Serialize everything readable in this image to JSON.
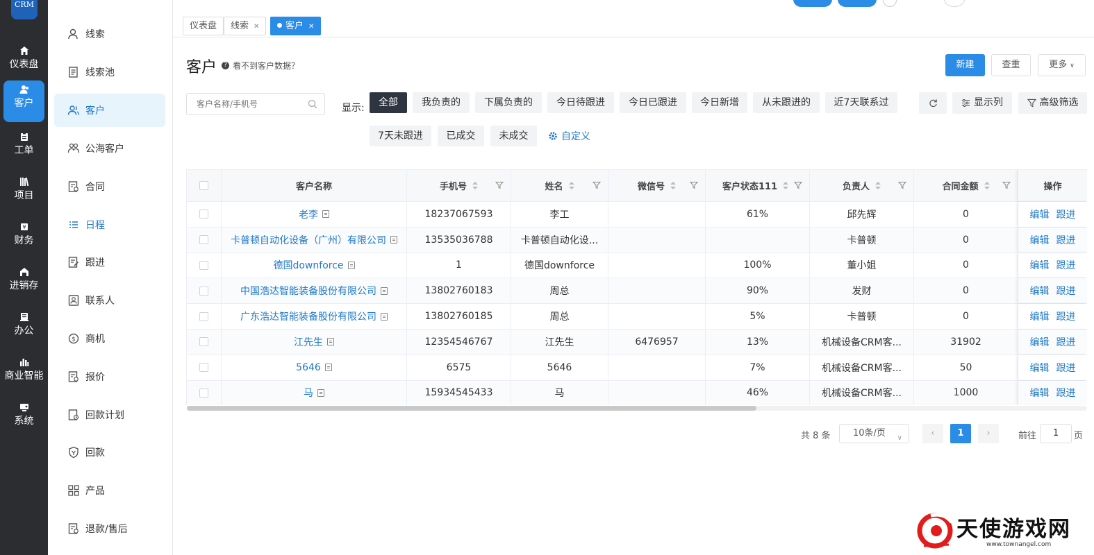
{
  "logo": {
    "text": "CRM"
  },
  "rail": [
    {
      "label": "仪表盘",
      "icon": "home-icon",
      "active": false
    },
    {
      "label": "客户",
      "icon": "user-icon",
      "active": true
    },
    {
      "label": "工单",
      "icon": "clipboard-icon",
      "active": false
    },
    {
      "label": "项目",
      "icon": "books-icon",
      "active": false
    },
    {
      "label": "财务",
      "icon": "money-icon",
      "active": false
    },
    {
      "label": "进销存",
      "icon": "warehouse-icon",
      "active": false
    },
    {
      "label": "办公",
      "icon": "office-icon",
      "active": false
    },
    {
      "label": "商业智能",
      "icon": "bar-chart-icon",
      "active": false
    },
    {
      "label": "系统",
      "icon": "system-icon",
      "active": false
    }
  ],
  "sidebar": [
    {
      "label": "线索",
      "icon": "person-icon"
    },
    {
      "label": "线索池",
      "icon": "document-list-icon"
    },
    {
      "label": "客户",
      "icon": "people-icon",
      "active": true
    },
    {
      "label": "公海客户",
      "icon": "group-users-icon"
    },
    {
      "label": "合同",
      "icon": "contract-icon"
    },
    {
      "label": "日程",
      "icon": "schedule-list-icon",
      "blue": true
    },
    {
      "label": "跟进",
      "icon": "edit-document-icon"
    },
    {
      "label": "联系人",
      "icon": "contact-card-icon"
    },
    {
      "label": "商机",
      "icon": "opportunity-icon"
    },
    {
      "label": "报价",
      "icon": "quote-icon"
    },
    {
      "label": "回款计划",
      "icon": "payment-plan-icon"
    },
    {
      "label": "回款",
      "icon": "payment-icon"
    },
    {
      "label": "产品",
      "icon": "product-grid-icon"
    },
    {
      "label": "退款/售后",
      "icon": "refund-icon"
    }
  ],
  "tabs": [
    {
      "label": "仪表盘",
      "closable": false
    },
    {
      "label": "线索",
      "closable": true
    },
    {
      "label": "客户",
      "closable": true,
      "active": true
    }
  ],
  "page": {
    "title": "客户",
    "hint": "看不到客户数据？",
    "new_button": "新建",
    "check_button": "查重",
    "more_button": "更多"
  },
  "search": {
    "placeholder": "客户名称/手机号"
  },
  "filters": {
    "label": "显示:",
    "chips": [
      "全部",
      "我负责的",
      "下属负责的",
      "今日待跟进",
      "今日已跟进",
      "今日新增",
      "从未跟进的",
      "近7天联系过",
      "7天未跟进",
      "已成交",
      "未成交"
    ],
    "active_index": 0,
    "custom": "自定义"
  },
  "tools": {
    "refresh_icon": "refresh-icon",
    "columns": "显示列",
    "advanced": "高级筛选"
  },
  "table": {
    "headers": [
      "客户名称",
      "手机号",
      "姓名",
      "微信号",
      "客户状态111",
      "负责人",
      "合同金额",
      "操作"
    ],
    "rows": [
      {
        "name": "老李",
        "phone": "18237067593",
        "contact": "李工",
        "wechat": "",
        "status": "61%",
        "owner": "邱先辉",
        "amount": "0"
      },
      {
        "name": "卡普顿自动化设备（广州）有限公司",
        "phone": "13535036788",
        "contact": "卡普顿自动化设...",
        "wechat": "",
        "status": "",
        "owner": "卡普顿",
        "amount": "0"
      },
      {
        "name": "德国downforce",
        "phone": "1",
        "contact": "德国downforce",
        "wechat": "",
        "status": "100%",
        "owner": "董小姐",
        "amount": "0"
      },
      {
        "name": "中国浩达智能装备股份有限公司",
        "phone": "13802760183",
        "contact": "周总",
        "wechat": "",
        "status": "90%",
        "owner": "发财",
        "amount": "0"
      },
      {
        "name": "广东浩达智能装备股份有限公司",
        "phone": "13802760185",
        "contact": "周总",
        "wechat": "",
        "status": "5%",
        "owner": "卡普顿",
        "amount": "0"
      },
      {
        "name": "江先生",
        "phone": "12354546767",
        "contact": "江先生",
        "wechat": "6476957",
        "status": "13%",
        "owner": "机械设备CRM客...",
        "amount": "31902"
      },
      {
        "name": "5646",
        "phone": "6575",
        "contact": "5646",
        "wechat": "",
        "status": "7%",
        "owner": "机械设备CRM客...",
        "amount": "50"
      },
      {
        "name": "马",
        "phone": "15934545433",
        "contact": "马",
        "wechat": "",
        "status": "46%",
        "owner": "机械设备CRM客...",
        "amount": "1000"
      }
    ],
    "actions": [
      "编辑",
      "跟进"
    ]
  },
  "pagination": {
    "total": "共 8 条",
    "page_size": "10条/页",
    "current": "1",
    "goto_label": "前往",
    "goto_value": "1",
    "page_suffix": "页"
  },
  "watermark": {
    "text": "天使游戏网",
    "url": "www.townangel.com"
  },
  "colors": {
    "accent": "#2b8ce8",
    "rail_bg": "#2b2d30",
    "active_chip": "#2e3440",
    "link": "#1f79c8"
  }
}
